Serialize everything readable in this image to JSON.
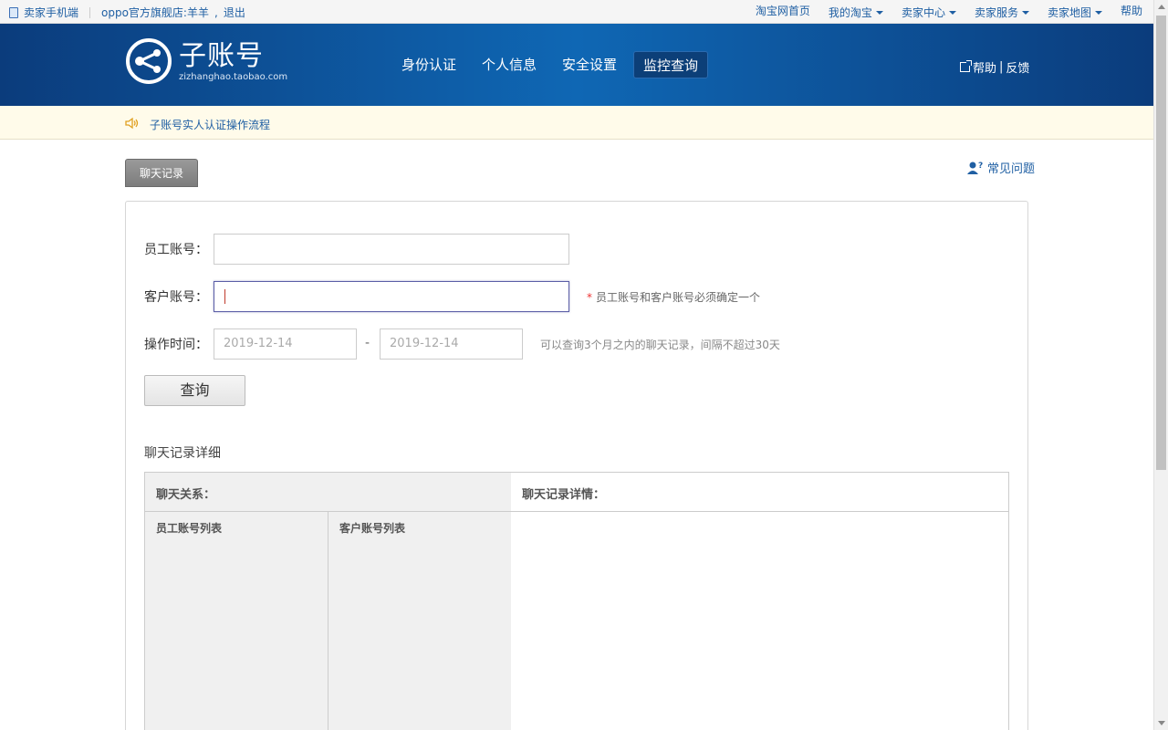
{
  "topbar": {
    "seller_mobile": "卖家手机端",
    "store_user": "oppo官方旗舰店:羊羊",
    "logout": "退出",
    "taobao_home": "淘宝网首页",
    "my_taobao": "我的淘宝",
    "seller_center": "卖家中心",
    "seller_service": "卖家服务",
    "seller_map": "卖家地图",
    "help": "帮助"
  },
  "header": {
    "logo_title": "子账号",
    "logo_sub": "zizhanghao.taobao.com",
    "nav": [
      "身份认证",
      "个人信息",
      "安全设置",
      "监控查询"
    ],
    "active_nav": "监控查询",
    "help": "帮助",
    "feedback": "反馈"
  },
  "notice": {
    "text": "子账号实人认证操作流程"
  },
  "tab": {
    "chat_records": "聊天记录"
  },
  "faq": "常见问题",
  "form": {
    "employee_label": "员工账号：",
    "employee_value": "",
    "customer_label": "客户账号：",
    "customer_value": "",
    "required_hint": "员工账号和客户账号必须确定一个",
    "required_star": "*",
    "time_label": "操作时间：",
    "start_date": "2019-12-14",
    "end_date": "2019-12-14",
    "date_sep": "-",
    "time_hint": "可以查询3个月之内的聊天记录，间隔不超过30天",
    "query_button": "查询"
  },
  "details": {
    "title": "聊天记录详细",
    "relation_header": "聊天关系：",
    "detail_header": "聊天记录详情：",
    "employee_list": "员工账号列表",
    "customer_list": "客户账号列表"
  },
  "colors": {
    "header_dark": "#0b3c7c",
    "header_mid": "#0f67b4",
    "link": "#1f5fa3",
    "notice_bg": "#fffbea",
    "focus_border": "#5b5ea6"
  }
}
